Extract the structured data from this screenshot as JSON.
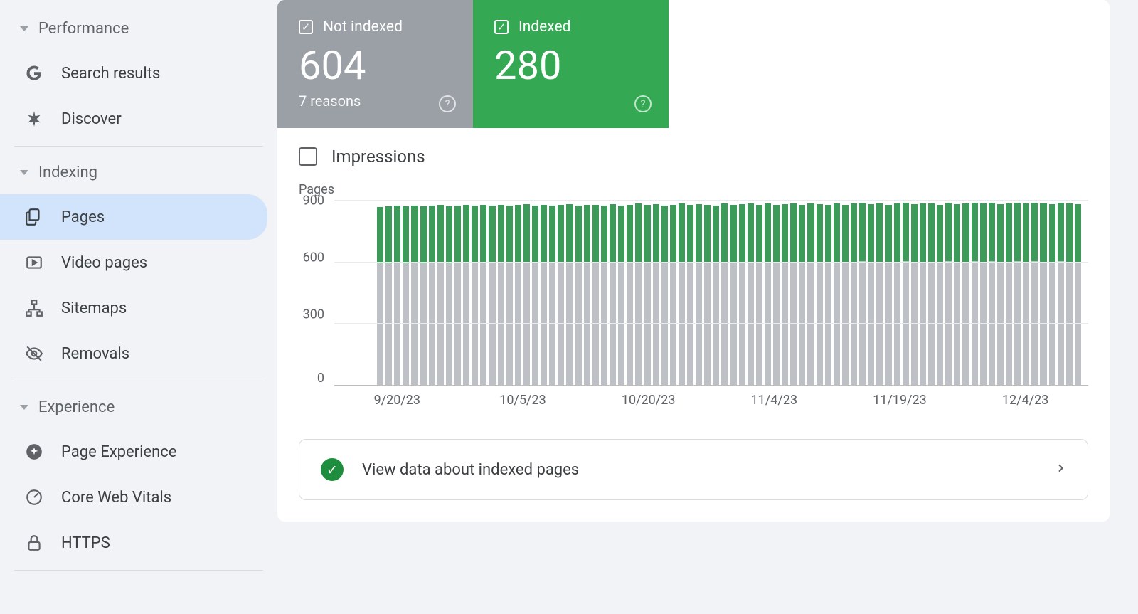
{
  "sidebar": {
    "sections": [
      {
        "label": "Performance",
        "items": [
          {
            "key": "search-results",
            "label": "Search results"
          },
          {
            "key": "discover",
            "label": "Discover"
          }
        ]
      },
      {
        "label": "Indexing",
        "items": [
          {
            "key": "pages",
            "label": "Pages",
            "active": true
          },
          {
            "key": "video-pages",
            "label": "Video pages"
          },
          {
            "key": "sitemaps",
            "label": "Sitemaps"
          },
          {
            "key": "removals",
            "label": "Removals"
          }
        ]
      },
      {
        "label": "Experience",
        "items": [
          {
            "key": "page-experience",
            "label": "Page Experience"
          },
          {
            "key": "core-web-vitals",
            "label": "Core Web Vitals"
          },
          {
            "key": "https",
            "label": "HTTPS"
          }
        ]
      }
    ]
  },
  "stats": {
    "not_indexed": {
      "label": "Not indexed",
      "value": "604",
      "sub": "7 reasons"
    },
    "indexed": {
      "label": "Indexed",
      "value": "280"
    }
  },
  "impressions_label": "Impressions",
  "action": {
    "label": "View data about indexed pages"
  },
  "chart_data": {
    "type": "bar",
    "title": "",
    "y_axis_label": "Pages",
    "ylim": [
      0,
      900
    ],
    "y_ticks": [
      900,
      600,
      300,
      0
    ],
    "x_ticks": [
      "9/20/23",
      "10/5/23",
      "10/20/23",
      "11/4/23",
      "11/19/23",
      "12/4/23"
    ],
    "series": [
      {
        "name": "Indexed",
        "color": "#34a853"
      },
      {
        "name": "Not indexed",
        "color": "#9aa0a6"
      }
    ],
    "bars": [
      {
        "indexed": 275,
        "not_indexed": 595
      },
      {
        "indexed": 276,
        "not_indexed": 596
      },
      {
        "indexed": 278,
        "not_indexed": 598
      },
      {
        "indexed": 277,
        "not_indexed": 597
      },
      {
        "indexed": 279,
        "not_indexed": 599
      },
      {
        "indexed": 276,
        "not_indexed": 596
      },
      {
        "indexed": 278,
        "not_indexed": 598
      },
      {
        "indexed": 280,
        "not_indexed": 600
      },
      {
        "indexed": 277,
        "not_indexed": 597
      },
      {
        "indexed": 279,
        "not_indexed": 599
      },
      {
        "indexed": 281,
        "not_indexed": 601
      },
      {
        "indexed": 278,
        "not_indexed": 598
      },
      {
        "indexed": 280,
        "not_indexed": 600
      },
      {
        "indexed": 279,
        "not_indexed": 599
      },
      {
        "indexed": 281,
        "not_indexed": 601
      },
      {
        "indexed": 278,
        "not_indexed": 598
      },
      {
        "indexed": 280,
        "not_indexed": 600
      },
      {
        "indexed": 282,
        "not_indexed": 602
      },
      {
        "indexed": 279,
        "not_indexed": 599
      },
      {
        "indexed": 281,
        "not_indexed": 601
      },
      {
        "indexed": 278,
        "not_indexed": 598
      },
      {
        "indexed": 280,
        "not_indexed": 600
      },
      {
        "indexed": 282,
        "not_indexed": 602
      },
      {
        "indexed": 279,
        "not_indexed": 599
      },
      {
        "indexed": 281,
        "not_indexed": 601
      },
      {
        "indexed": 280,
        "not_indexed": 600
      },
      {
        "indexed": 278,
        "not_indexed": 598
      },
      {
        "indexed": 282,
        "not_indexed": 602
      },
      {
        "indexed": 279,
        "not_indexed": 599
      },
      {
        "indexed": 281,
        "not_indexed": 601
      },
      {
        "indexed": 283,
        "not_indexed": 603
      },
      {
        "indexed": 280,
        "not_indexed": 600
      },
      {
        "indexed": 282,
        "not_indexed": 602
      },
      {
        "indexed": 279,
        "not_indexed": 599
      },
      {
        "indexed": 281,
        "not_indexed": 601
      },
      {
        "indexed": 283,
        "not_indexed": 603
      },
      {
        "indexed": 280,
        "not_indexed": 600
      },
      {
        "indexed": 282,
        "not_indexed": 602
      },
      {
        "indexed": 281,
        "not_indexed": 601
      },
      {
        "indexed": 279,
        "not_indexed": 599
      },
      {
        "indexed": 283,
        "not_indexed": 603
      },
      {
        "indexed": 280,
        "not_indexed": 600
      },
      {
        "indexed": 282,
        "not_indexed": 602
      },
      {
        "indexed": 284,
        "not_indexed": 604
      },
      {
        "indexed": 281,
        "not_indexed": 601
      },
      {
        "indexed": 283,
        "not_indexed": 603
      },
      {
        "indexed": 280,
        "not_indexed": 600
      },
      {
        "indexed": 282,
        "not_indexed": 602
      },
      {
        "indexed": 284,
        "not_indexed": 604
      },
      {
        "indexed": 281,
        "not_indexed": 601
      },
      {
        "indexed": 283,
        "not_indexed": 603
      },
      {
        "indexed": 282,
        "not_indexed": 602
      },
      {
        "indexed": 280,
        "not_indexed": 600
      },
      {
        "indexed": 284,
        "not_indexed": 604
      },
      {
        "indexed": 281,
        "not_indexed": 601
      },
      {
        "indexed": 283,
        "not_indexed": 603
      },
      {
        "indexed": 285,
        "not_indexed": 605
      },
      {
        "indexed": 282,
        "not_indexed": 602
      },
      {
        "indexed": 284,
        "not_indexed": 604
      },
      {
        "indexed": 281,
        "not_indexed": 601
      },
      {
        "indexed": 283,
        "not_indexed": 603
      },
      {
        "indexed": 285,
        "not_indexed": 605
      },
      {
        "indexed": 282,
        "not_indexed": 602
      },
      {
        "indexed": 284,
        "not_indexed": 604
      },
      {
        "indexed": 283,
        "not_indexed": 603
      },
      {
        "indexed": 281,
        "not_indexed": 601
      },
      {
        "indexed": 285,
        "not_indexed": 605
      },
      {
        "indexed": 282,
        "not_indexed": 602
      },
      {
        "indexed": 284,
        "not_indexed": 604
      },
      {
        "indexed": 286,
        "not_indexed": 605
      },
      {
        "indexed": 283,
        "not_indexed": 603
      },
      {
        "indexed": 285,
        "not_indexed": 605
      },
      {
        "indexed": 282,
        "not_indexed": 602
      },
      {
        "indexed": 284,
        "not_indexed": 604
      },
      {
        "indexed": 286,
        "not_indexed": 605
      },
      {
        "indexed": 283,
        "not_indexed": 603
      },
      {
        "indexed": 285,
        "not_indexed": 605
      },
      {
        "indexed": 284,
        "not_indexed": 604
      },
      {
        "indexed": 282,
        "not_indexed": 602
      },
      {
        "indexed": 286,
        "not_indexed": 605
      },
      {
        "indexed": 283,
        "not_indexed": 603
      },
      {
        "indexed": 280,
        "not_indexed": 604
      }
    ]
  }
}
